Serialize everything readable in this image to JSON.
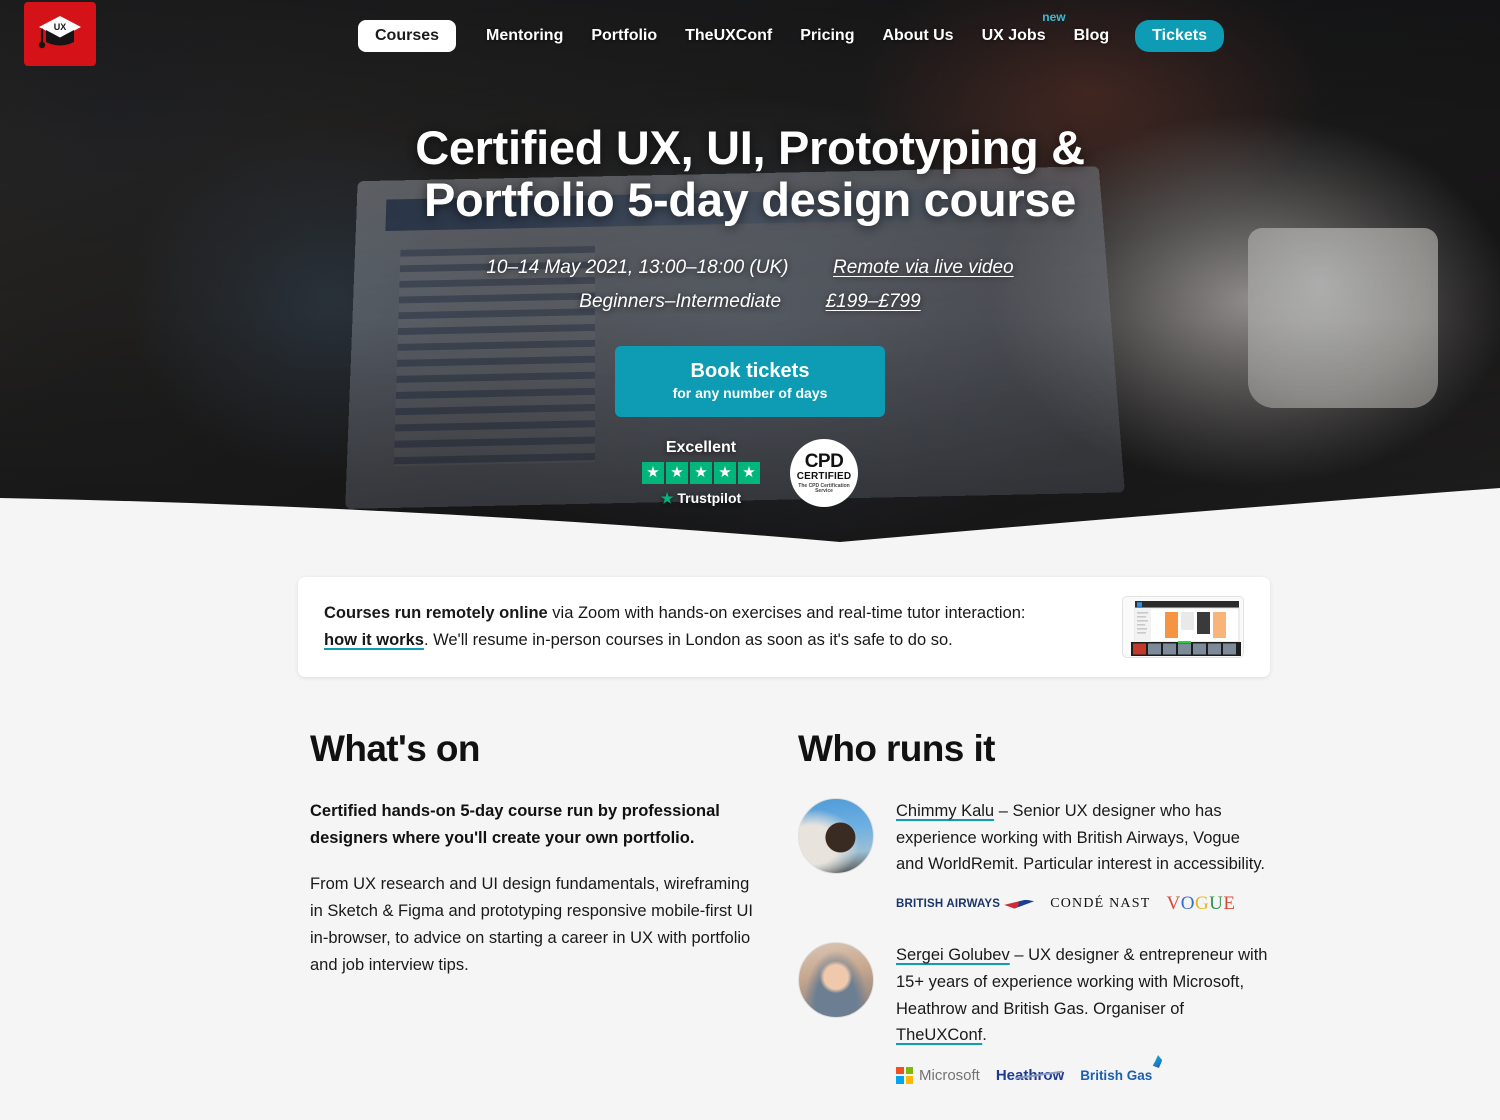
{
  "brand": {
    "logo_icon": "graduation-cap-logo",
    "logo_text": "UX",
    "logo_color": "#d41217"
  },
  "colors": {
    "accent_teal": "#0d9cb4",
    "trustpilot_green": "#00b67a",
    "page_background": "#f5f5f5"
  },
  "nav": {
    "items": [
      {
        "label": "Courses",
        "style": "pill-white"
      },
      {
        "label": "Mentoring",
        "style": "plain"
      },
      {
        "label": "Portfolio",
        "style": "plain"
      },
      {
        "label": "TheUXConf",
        "style": "plain"
      },
      {
        "label": "Pricing",
        "style": "plain"
      },
      {
        "label": "About Us",
        "style": "plain"
      },
      {
        "label": "UX Jobs",
        "style": "plain",
        "badge": "new"
      },
      {
        "label": "Blog",
        "style": "plain"
      },
      {
        "label": "Tickets",
        "style": "pill-teal"
      }
    ]
  },
  "hero": {
    "title_line1": "Certified UX, UI, Prototyping &",
    "title_line2": "Portfolio 5-day design course",
    "dates": "10–14 May 2021, 13:00–18:00 (UK)",
    "format_link": "Remote via live video",
    "level": "Beginners–Intermediate",
    "price_link": "£199–£799",
    "cta_main": "Book tickets",
    "cta_sub": "for any number of days",
    "trustpilot": {
      "rating_word": "Excellent",
      "stars": 5,
      "name": "Trustpilot"
    },
    "cpd_badge": {
      "line1": "CPD",
      "line2": "CERTIFIED",
      "line3": "The CPD Certification Service"
    }
  },
  "notice": {
    "bold_prefix": "Courses run remotely online",
    "text_1": " via Zoom with hands-on exercises and real-time tutor interaction: ",
    "link": "how it works",
    "text_2": ". We'll resume in-person courses in London as soon as it's safe to do so.",
    "thumbnail_icon": "zoom-session-thumbnail"
  },
  "whats_on": {
    "heading": "What's on",
    "lead": "Certified hands-on 5-day course run by professional designers where you'll create your own portfolio.",
    "body": "From UX research and UI design fundamentals, wireframing in Sketch & Figma and prototyping responsive mobile-first UI in-browser, to advice on starting a career in UX with portfolio and job interview tips."
  },
  "who_runs_it": {
    "heading": "Who runs it",
    "people": [
      {
        "name": "Chimmy Kalu",
        "bio_1": " – Senior UX designer who has experience working with British Airways, Vogue and WorldRemit. Particular interest in accessibility.",
        "avatar_icon": "avatar-chimmy-kalu",
        "logos": [
          "BRITISH AIRWAYS",
          "CONDÉ NAST",
          "VOGUE"
        ]
      },
      {
        "name": "Sergei Golubev",
        "bio_1": " – UX designer & entrepreneur with 15+ years of experience working with Microsoft, Heathrow and British Gas. Organiser of ",
        "bio_link": "TheUXConf",
        "bio_2": ".",
        "avatar_icon": "avatar-sergei-golubev",
        "logos": [
          "Microsoft",
          "Heathrow",
          "British Gas"
        ]
      }
    ]
  }
}
